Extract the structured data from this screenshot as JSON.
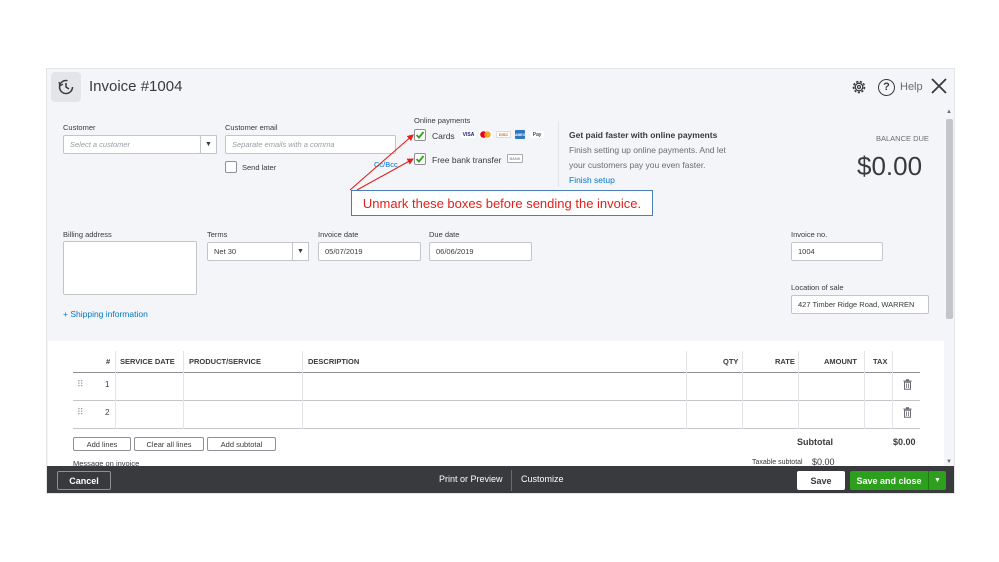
{
  "header": {
    "title": "Invoice #1004",
    "help_label": "Help"
  },
  "customer": {
    "label": "Customer",
    "placeholder": "Select a customer"
  },
  "email": {
    "label": "Customer email",
    "placeholder": "Separate emails with a comma",
    "send_later": "Send later",
    "cc_bcc": "Cc/Bcc"
  },
  "online_payments": {
    "label": "Online payments",
    "cards_label": "Cards",
    "bank_label": "Free bank transfer",
    "bank_badge": "BANK",
    "card_logos": [
      {
        "name": "VISA",
        "bg": "#ffffff",
        "fg": "#1a1f71"
      },
      {
        "name": "MC",
        "bg": "#eb001b",
        "fg": "#f79e1b"
      },
      {
        "name": "DISC",
        "bg": "#ffffff",
        "fg": "#e55c20"
      },
      {
        "name": "AMEX",
        "bg": "#2e77bc",
        "fg": "#ffffff"
      },
      {
        "name": "Pay",
        "bg": "#ffffff",
        "fg": "#000000"
      }
    ]
  },
  "promo": {
    "title": "Get paid faster with online payments",
    "body_line1": "Finish setting up online payments. And let",
    "body_line2": "your customers pay you even faster.",
    "link": "Finish setup"
  },
  "balance": {
    "label": "BALANCE DUE",
    "amount": "$0.00"
  },
  "callout": {
    "text": "Unmark these boxes before sending the invoice."
  },
  "billing": {
    "label": "Billing address",
    "shipping_link": "+ Shipping information"
  },
  "terms": {
    "label": "Terms",
    "value": "Net 30"
  },
  "invoice_date": {
    "label": "Invoice date",
    "value": "05/07/2019"
  },
  "due_date": {
    "label": "Due date",
    "value": "06/06/2019"
  },
  "invoice_no": {
    "label": "Invoice no.",
    "value": "1004"
  },
  "location": {
    "label": "Location of sale",
    "value": "427 Timber Ridge Road, WARREN"
  },
  "table": {
    "headers": {
      "num": "#",
      "service_date": "SERVICE DATE",
      "product": "PRODUCT/SERVICE",
      "description": "DESCRIPTION",
      "qty": "QTY",
      "rate": "RATE",
      "amount": "AMOUNT",
      "tax": "TAX"
    },
    "rows": [
      {
        "num": "1"
      },
      {
        "num": "2"
      }
    ],
    "buttons": {
      "add_lines": "Add lines",
      "clear_all": "Clear all lines",
      "add_subtotal": "Add subtotal"
    },
    "subtotal_label": "Subtotal",
    "subtotal_value": "$0.00",
    "message_label": "Message on invoice",
    "taxable_label": "Taxable subtotal",
    "taxable_value": "$0.00"
  },
  "footer": {
    "cancel": "Cancel",
    "print_preview": "Print or Preview",
    "customize": "Customize",
    "save": "Save",
    "save_close": "Save and close"
  },
  "colors": {
    "accent_green": "#2ca01c",
    "link_blue": "#0077c5",
    "footer_bg": "#393a3d",
    "callout_red": "#e0201b"
  }
}
